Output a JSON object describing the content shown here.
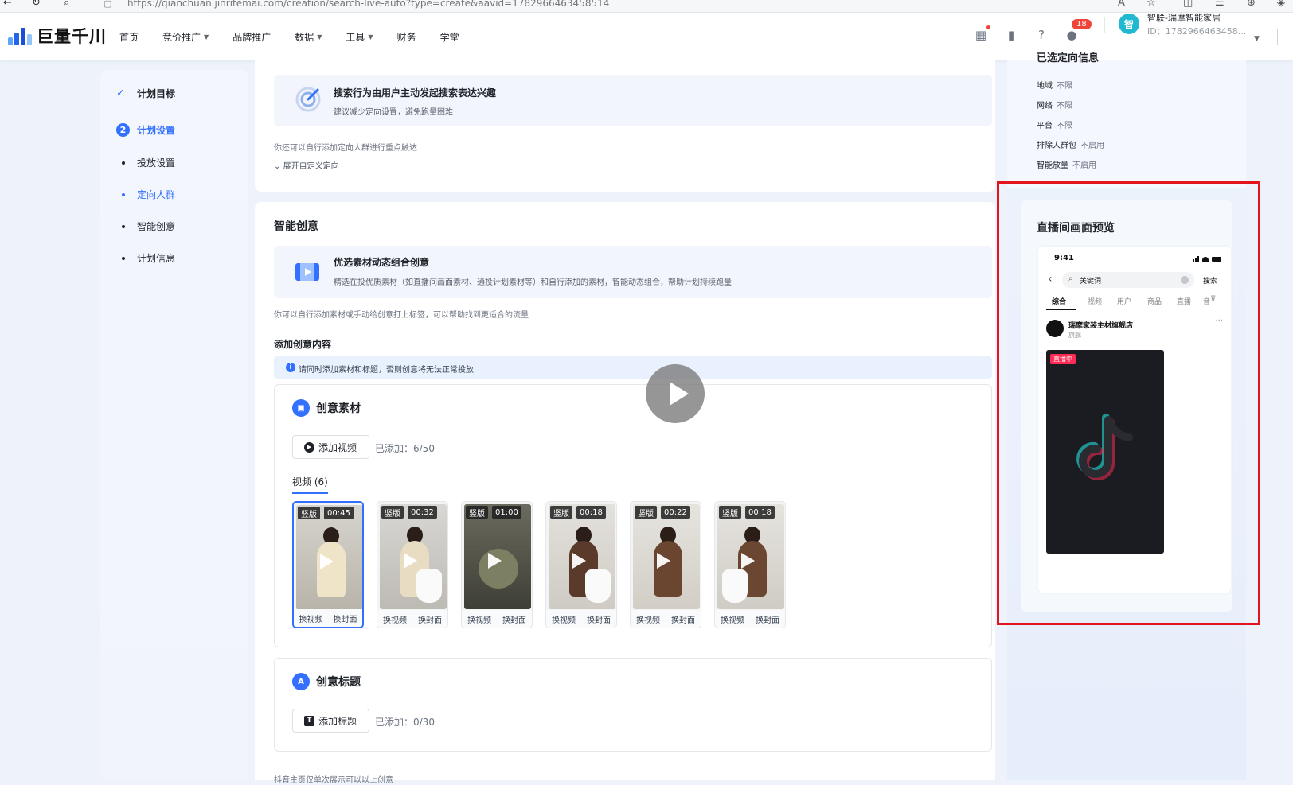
{
  "browser": {
    "url": "https://qianchuan.jinritemai.com/creation/search-live-auto?type=create&aavid=1782966463458514",
    "nav_icons": [
      "back-icon",
      "refresh-icon",
      "search-icon"
    ],
    "right_icons": [
      "read-aloud-icon",
      "favorite-icon",
      "split-icon",
      "favorites-list-icon",
      "extensions-icon",
      "copilot-icon"
    ]
  },
  "header": {
    "logo_text": "巨量千川",
    "menu": [
      {
        "label": "首页",
        "dropdown": false
      },
      {
        "label": "竞价推广",
        "dropdown": true
      },
      {
        "label": "品牌推广",
        "dropdown": false
      },
      {
        "label": "数据",
        "dropdown": true
      },
      {
        "label": "工具",
        "dropdown": true
      },
      {
        "label": "财务",
        "dropdown": false
      },
      {
        "label": "学堂",
        "dropdown": false
      }
    ],
    "notification_count": "18",
    "account": {
      "avatar_text": "智",
      "name": "智联-瑞摩智能家居",
      "id": "ID：1782966463458..."
    }
  },
  "steps": {
    "items": [
      {
        "label": "计划目标",
        "state": "done"
      },
      {
        "label": "计划设置",
        "state": "active",
        "number": "2"
      },
      {
        "label": "投放设置",
        "state": "sub"
      },
      {
        "label": "定向人群",
        "state": "sub-active"
      },
      {
        "label": "智能创意",
        "state": "sub"
      },
      {
        "label": "计划信息",
        "state": "sub"
      }
    ]
  },
  "targeting": {
    "info_title": "搜索行为由用户主动发起搜索表达兴趣",
    "info_desc": "建议减少定向设置，避免跑量困难",
    "hint": "你还可以自行添加定向人群进行重点触达",
    "expand_label": "展开自定义定向"
  },
  "creative": {
    "section_title": "智能创意",
    "info_title": "优选素材动态组合创意",
    "info_desc": "精选在投优质素材（如直播间画面素材、通投计划素材等）和自行添加的素材，智能动态组合，帮助计划持续跑量",
    "hint": "你可以自行添加素材或手动给创意打上标签，可以帮助找到更适合的流量",
    "add_content_title": "添加创意内容",
    "notice": "请同时添加素材和标题，否则创意将无法正常投放",
    "material": {
      "title": "创意素材",
      "add_button": "添加视频",
      "added_label": "已添加：6/50",
      "tab_label": "视频 (6)",
      "videos": [
        {
          "format": "竖版",
          "duration": "00:45",
          "selected": true
        },
        {
          "format": "竖版",
          "duration": "00:32",
          "selected": false
        },
        {
          "format": "竖版",
          "duration": "01:00",
          "selected": false
        },
        {
          "format": "竖版",
          "duration": "00:18",
          "selected": false
        },
        {
          "format": "竖版",
          "duration": "00:22",
          "selected": false
        },
        {
          "format": "竖版",
          "duration": "00:18",
          "selected": false
        }
      ],
      "replace_video": "换视频",
      "replace_cover": "换封面"
    },
    "headline": {
      "title": "创意标题",
      "add_button": "添加标题",
      "added_label": "已添加：0/30"
    },
    "footer_hint": "抖音主页仅单次展示可以以上创意"
  },
  "summary": {
    "heading": "已选定向信息",
    "rows": [
      {
        "label": "地域",
        "value": "不限"
      },
      {
        "label": "网络",
        "value": "不限"
      },
      {
        "label": "平台",
        "value": "不限"
      },
      {
        "label": "排除人群包",
        "value": "不启用"
      },
      {
        "label": "智能放量",
        "value": "不启用"
      }
    ]
  },
  "preview": {
    "title": "直播间画面预览",
    "time": "9:41",
    "search_placeholder": "关键词",
    "search_button": "搜索",
    "tabs": [
      "综合",
      "视频",
      "用户",
      "商品",
      "直播",
      "音"
    ],
    "shop_name": "瑞摩家装主材旗舰店",
    "shop_sub": "旗舰",
    "live_badge": "直播中"
  },
  "colors": {
    "accent": "#3370ff",
    "highlight_box": "#e3141c",
    "live_badge": "#fe2c55"
  }
}
